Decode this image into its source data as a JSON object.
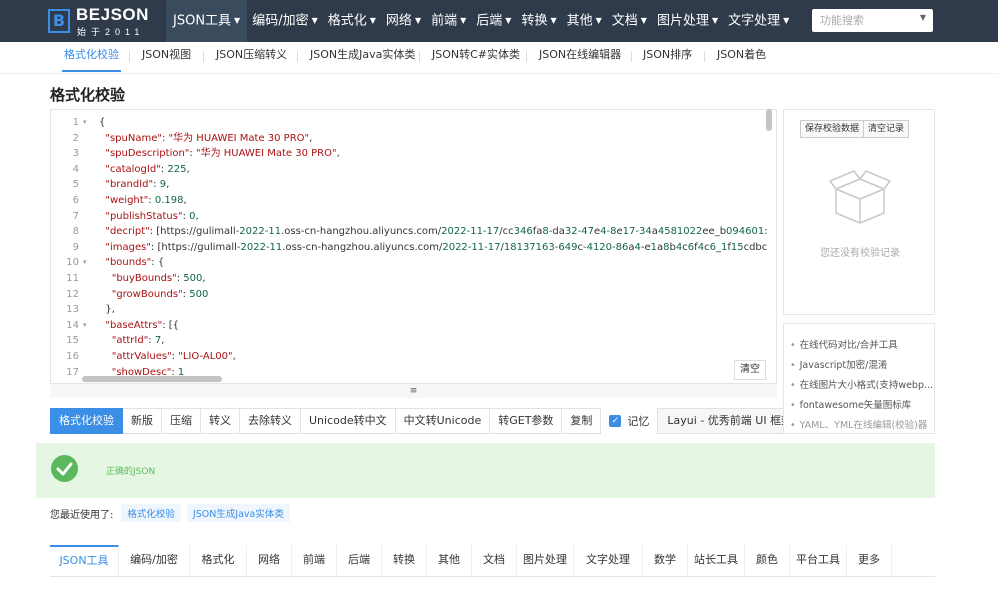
{
  "brand": {
    "logo_mark": "B",
    "name": "BEJSON",
    "sub": "始于2011"
  },
  "nav": {
    "items": [
      {
        "label": "JSON工具",
        "active": true
      },
      {
        "label": "编码/加密"
      },
      {
        "label": "格式化"
      },
      {
        "label": "网络"
      },
      {
        "label": "前端"
      },
      {
        "label": "后端"
      },
      {
        "label": "转换"
      },
      {
        "label": "其他"
      },
      {
        "label": "文档"
      },
      {
        "label": "图片处理"
      },
      {
        "label": "文字处理"
      }
    ],
    "search_placeholder": "功能搜索"
  },
  "subtabs": [
    "格式化校验",
    "JSON视图",
    "JSON压缩转义",
    "JSON生成Java实体类",
    "JSON转C#实体类",
    "JSON在线编辑器",
    "JSON排序",
    "JSON着色"
  ],
  "page_title": "格式化校验",
  "editor": {
    "lines": [
      {
        "n": "1",
        "fold": true,
        "text": "{"
      },
      {
        "n": "2",
        "text": "  \"spuName\": \"华为 HUAWEI Mate 30 PRO\","
      },
      {
        "n": "3",
        "text": "  \"spuDescription\": \"华为 HUAWEI Mate 30 PRO\","
      },
      {
        "n": "4",
        "text": "  \"catalogId\": 225,"
      },
      {
        "n": "5",
        "text": "  \"brandId\": 9,"
      },
      {
        "n": "6",
        "text": "  \"weight\": 0.198,"
      },
      {
        "n": "7",
        "text": "  \"publishStatus\": 0,"
      },
      {
        "n": "8",
        "text": "  \"decript\": [\"https://gulimall-2022-11.oss-cn-hangzhou.aliyuncs.com/2022-11-17/cc346fa8-da32-47e4-8e17-34a4581022ee_b094601:"
      },
      {
        "n": "9",
        "text": "  \"images\": [\"https://gulimall-2022-11.oss-cn-hangzhou.aliyuncs.com/2022-11-17/18137163-649c-4120-86a4-e1a8b4c6f4c6_1f15cdbc"
      },
      {
        "n": "10",
        "fold": true,
        "text": "  \"bounds\": {"
      },
      {
        "n": "11",
        "text": "    \"buyBounds\": 500,"
      },
      {
        "n": "12",
        "text": "    \"growBounds\": 500"
      },
      {
        "n": "13",
        "text": "  },"
      },
      {
        "n": "14",
        "fold": true,
        "text": "  \"baseAttrs\": [{"
      },
      {
        "n": "15",
        "text": "    \"attrId\": 7,"
      },
      {
        "n": "16",
        "text": "    \"attrValues\": \"LIO-AL00\","
      },
      {
        "n": "17",
        "text": "    \"showDesc\": 1"
      }
    ],
    "clear_label": "清空",
    "resize_glyph": "≡"
  },
  "toolbar": {
    "buttons": [
      "格式化校验",
      "新版",
      "压缩",
      "转义",
      "去除转义",
      "Unicode转中文",
      "中文转Unicode",
      "转GET参数",
      "复制"
    ],
    "remember_label": "记忆",
    "remember_checked": true,
    "layui_label": "Layui - 优秀前端 UI 框架"
  },
  "right_panel": {
    "save_label": "保存校验数据",
    "clear_label": "清空记录",
    "empty_text": "您还没有校验记录"
  },
  "links": [
    "在线代码对比/合并工具",
    "Javascript加密/混淆",
    "在线图片大小格式(支持webp...",
    "fontawesome矢量图标库",
    "YAML、YML在线编辑(校验)器"
  ],
  "success_text": "正确的JSON",
  "recent": {
    "label": "您最近使用了:",
    "tags": [
      "格式化校验",
      "JSON生成Java实体类"
    ]
  },
  "bottom_tabs": [
    "JSON工具",
    "编码/加密",
    "格式化",
    "网络",
    "前端",
    "后端",
    "转换",
    "其他",
    "文档",
    "图片处理",
    "文字处理",
    "数学",
    "站长工具",
    "颜色",
    "平台工具",
    "更多"
  ],
  "colors": {
    "nav_bg": "#2f3b4a",
    "accent": "#3a8ee6",
    "success": "#5cb85c",
    "success_bg": "#e5f7e3"
  }
}
